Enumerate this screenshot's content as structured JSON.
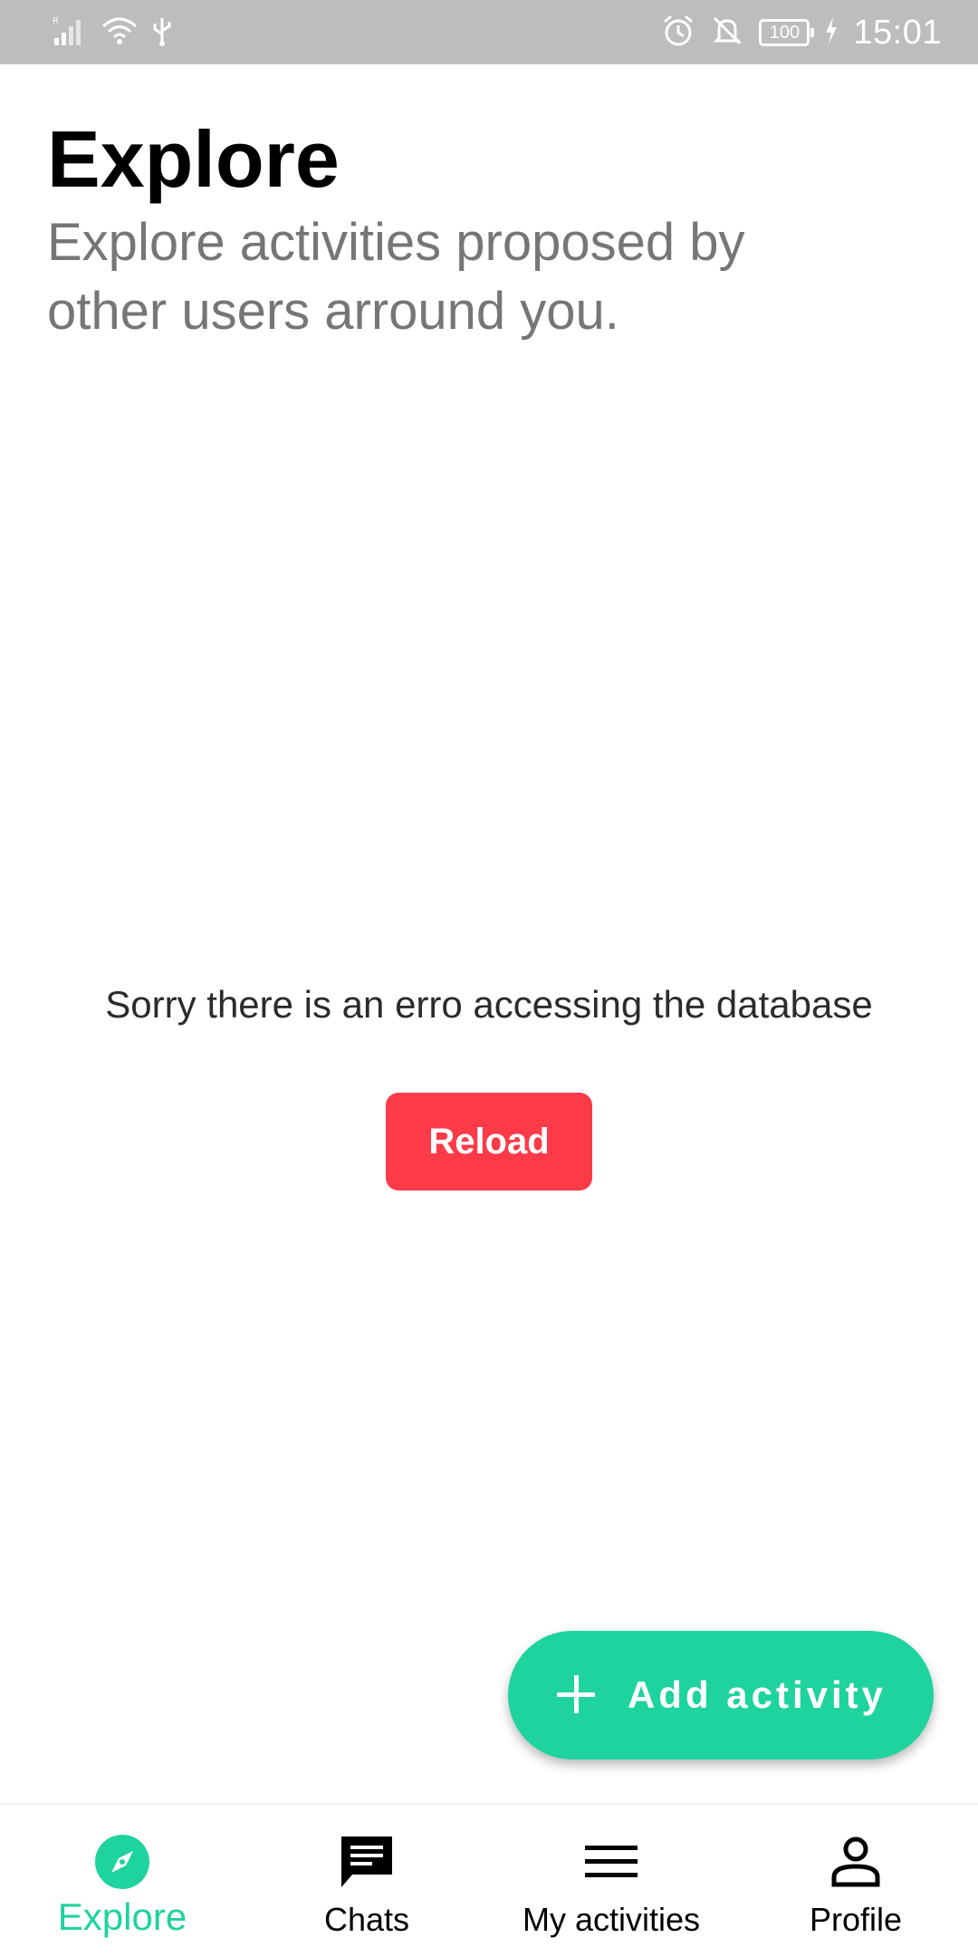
{
  "status_bar": {
    "time": "15:01",
    "battery": "100",
    "icons": [
      "signal-icon",
      "wifi-icon",
      "usb-icon",
      "alarm-icon",
      "notifications-off-icon",
      "battery-icon",
      "charging-icon"
    ]
  },
  "header": {
    "title": "Explore",
    "subtitle": "Explore activities proposed by other users arround you."
  },
  "error": {
    "message": "Sorry there is an erro accessing the database",
    "reload_label": "Reload"
  },
  "fab": {
    "label": "Add activity",
    "icon": "plus-icon"
  },
  "bottom_nav": {
    "items": [
      {
        "label": "Explore",
        "icon": "compass-icon",
        "active": true
      },
      {
        "label": "Chats",
        "icon": "chat-icon",
        "active": false
      },
      {
        "label": "My activities",
        "icon": "menu-icon",
        "active": false
      },
      {
        "label": "Profile",
        "icon": "person-icon",
        "active": false
      }
    ]
  },
  "colors": {
    "accent": "#1ed39e",
    "error_button": "#fc3a48",
    "subtitle": "#767676",
    "status_bar": "#bdbdbd"
  }
}
